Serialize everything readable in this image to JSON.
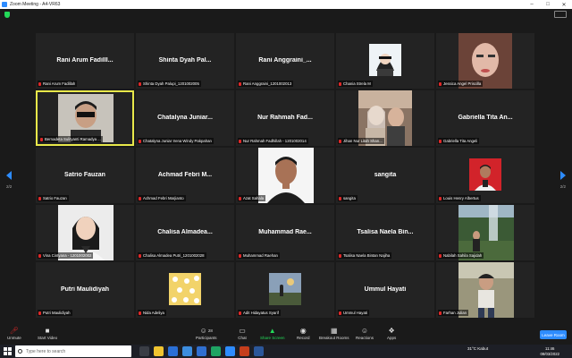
{
  "window": {
    "title": "Zoom Meeting - A4-VR63"
  },
  "pager": {
    "left": "2/2",
    "right": "2/2"
  },
  "tiles": [
    {
      "name": "Rani Arum Fadilll...",
      "label": "Rani Arum Fadillah"
    },
    {
      "name": "Shinta Dyah Pal...",
      "label": "Shinta Dyah Palupi_1201002005"
    },
    {
      "name": "Rani Anggraini_...",
      "label": "Rani Anggraini_1201002013"
    },
    {
      "name": "",
      "label": "Chania Strela M"
    },
    {
      "name": "",
      "label": "Jessica Angel Priscilla"
    },
    {
      "name": "",
      "label": "Bernadeta Sulityanti Ramadya ..."
    },
    {
      "name": "Chatalyna Juniar...",
      "label": "Chatalyna Juniar Irena Windy Pakpahan"
    },
    {
      "name": "Nur Rahmah Fad...",
      "label": "Nur Rahmah Fadhillah - 1201002014"
    },
    {
      "name": "",
      "label": "Jihan Nur Litah Shan..."
    },
    {
      "name": "Gabriella Tita An...",
      "label": "Gabriella Tita Angeli"
    },
    {
      "name": "Satrio Fauzan",
      "label": "Satrio Fauzan"
    },
    {
      "name": "Achmad Febri M...",
      "label": "Achmad Febri Marjianto"
    },
    {
      "name": "",
      "label": "Azat Sahala"
    },
    {
      "name": "sangita",
      "label": "sangita"
    },
    {
      "name": "",
      "label": "Louis Henry Albertus"
    },
    {
      "name": "",
      "label": "Vina Cintyana - 1201002002"
    },
    {
      "name": "Chalisa Almadea...",
      "label": "Chalisa Almadea Putri_1201002028"
    },
    {
      "name": "Muhammad Rae...",
      "label": "Muhammad Raehan"
    },
    {
      "name": "Tsalisa Naela Bin...",
      "label": "Tsalisa Naela Bintan Najiha"
    },
    {
      "name": "",
      "label": "Nabilah Sahila Sajidah"
    },
    {
      "name": "Putri Maulidiyah",
      "label": "Putri Maulidiyah"
    },
    {
      "name": "",
      "label": "Nida Adeliya"
    },
    {
      "name": "",
      "label": "Adit Hidayatus Syarif"
    },
    {
      "name": "Ummul Hayati",
      "label": "Ummul Hayati"
    },
    {
      "name": "",
      "label": "Farhan Julian"
    }
  ],
  "toolbar": {
    "unmute": "Unmute",
    "start_video": "Start Video",
    "participants": "Participants",
    "participants_count": "28",
    "chat": "Chat",
    "share_screen": "Share Screen",
    "record": "Record",
    "breakout_rooms": "Breakout Rooms",
    "reactions": "Reactions",
    "apps": "Apps",
    "leave": "Leave Room"
  },
  "taskbar": {
    "search_placeholder": "Type here to search",
    "weather": "31°C  Kabut",
    "time": "11:46",
    "date": "08/03/2022"
  },
  "colors": {
    "accent": "#2d8cff",
    "active_speaker": "#e8e84a",
    "muted": "#e02828",
    "share": "#23d959"
  }
}
